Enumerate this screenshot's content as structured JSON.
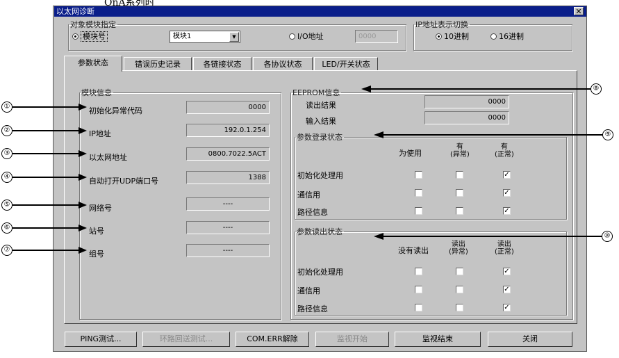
{
  "caption": "QnA系列时",
  "window": {
    "title": "以太网诊断",
    "close": "✕"
  },
  "target_group": {
    "legend": "对象模块指定",
    "radio_module_no": "模块号",
    "module_select": "模块1",
    "radio_io_address": "I/O地址",
    "io_address_value": "0000"
  },
  "ip_display_group": {
    "legend": "IP地址表示切换",
    "radio_decimal": "10进制",
    "radio_hex": "16进制"
  },
  "tabs": [
    "参数状态",
    "错误历史记录",
    "各链接状态",
    "各协议状态",
    "LED/开关状态"
  ],
  "module_info": {
    "legend": "模块信息",
    "rows": [
      {
        "label": "初始化异常代码",
        "value": "0000"
      },
      {
        "label": "IP地址",
        "value": "192.0.1.254"
      },
      {
        "label": "以太网地址",
        "value": "0800.7022.5ACT"
      },
      {
        "label": "自动打开UDP端口号",
        "value": "1388"
      },
      {
        "label": "网络号",
        "value": "----"
      },
      {
        "label": "站号",
        "value": "----"
      },
      {
        "label": "组号",
        "value": "----"
      }
    ]
  },
  "eeprom": {
    "legend": "EEPROM信息",
    "read_label": "读出结果",
    "read_value": "0000",
    "write_label": "输入结果",
    "write_value": "0000"
  },
  "param_register": {
    "legend": "参数登录状态",
    "col_unused": "为使用",
    "col_abnormal": "有\n(异常)",
    "col_normal": "有\n(正常)",
    "rows": [
      {
        "label": "初始化处理用",
        "checks": [
          false,
          false,
          true
        ]
      },
      {
        "label": "通信用",
        "checks": [
          false,
          false,
          true
        ]
      },
      {
        "label": "路径信息",
        "checks": [
          false,
          false,
          true
        ]
      }
    ]
  },
  "param_read": {
    "legend": "参数读出状态",
    "col_none": "没有读出",
    "col_abnormal": "读出\n(异常)",
    "col_normal": "读出\n(正常)",
    "rows": [
      {
        "label": "初始化处理用",
        "checks": [
          false,
          false,
          true
        ]
      },
      {
        "label": "通信用",
        "checks": [
          false,
          false,
          true
        ]
      },
      {
        "label": "路径信息",
        "checks": [
          false,
          false,
          true
        ]
      }
    ]
  },
  "buttons": {
    "ping": "PING测试...",
    "loop": "环路回送测试...",
    "com_err": "COM.ERR解除",
    "monitor_start": "监视开始",
    "monitor_stop": "监视结束",
    "close": "关闭"
  },
  "callouts": [
    "①",
    "②",
    "③",
    "④",
    "⑤",
    "⑥",
    "⑦",
    "⑧",
    "⑨",
    "⑩"
  ]
}
